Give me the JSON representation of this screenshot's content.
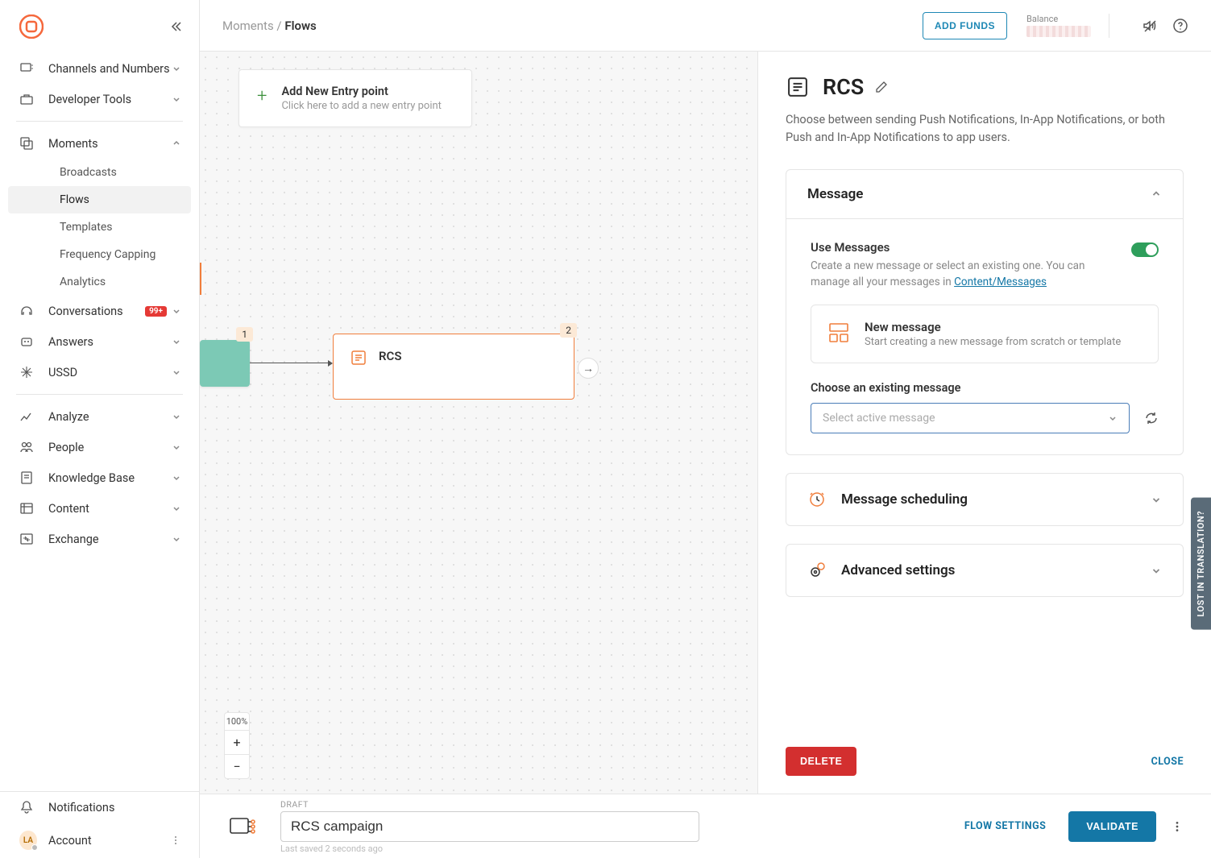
{
  "breadcrumb": {
    "parent": "Moments",
    "current": "Flows"
  },
  "topbar": {
    "add_funds": "ADD FUNDS",
    "balance_label": "Balance"
  },
  "sidebar": {
    "channels": "Channels and Numbers",
    "dev_tools": "Developer Tools",
    "moments": "Moments",
    "moments_items": {
      "broadcasts": "Broadcasts",
      "flows": "Flows",
      "templates": "Templates",
      "freq": "Frequency Capping",
      "analytics": "Analytics"
    },
    "conversations": "Conversations",
    "conversations_badge": "99+",
    "answers": "Answers",
    "ussd": "USSD",
    "analyze": "Analyze",
    "people": "People",
    "kb": "Knowledge Base",
    "content": "Content",
    "exchange": "Exchange",
    "notifications": "Notifications",
    "account": "Account",
    "account_initials": "LA"
  },
  "canvas": {
    "entry_title": "Add New Entry point",
    "entry_sub": "Click here to add a new entry point",
    "start_badge": "1",
    "rcs_badge": "2",
    "rcs_title": "RCS",
    "zoom": "100%"
  },
  "panel": {
    "title": "RCS",
    "desc": "Choose between sending Push Notifications, In-App Notifications, or both Push and In-App Notifications to app users.",
    "message": {
      "title": "Message",
      "use_title": "Use Messages",
      "use_desc_pre": "Create a new message or select an existing one. You can manage all your messages in ",
      "use_link": "Content/Messages",
      "new_title": "New message",
      "new_sub": "Start creating a new message from scratch or template",
      "choose_label": "Choose an existing message",
      "select_placeholder": "Select active message"
    },
    "scheduling_title": "Message scheduling",
    "advanced_title": "Advanced settings",
    "delete": "DELETE",
    "close": "CLOSE"
  },
  "bottom": {
    "draft": "DRAFT",
    "name": "RCS campaign",
    "saved": "Last saved 2 seconds ago",
    "flow_settings": "FLOW SETTINGS",
    "validate": "VALIDATE"
  },
  "side_tab": "LOST IN TRANSLATION?"
}
